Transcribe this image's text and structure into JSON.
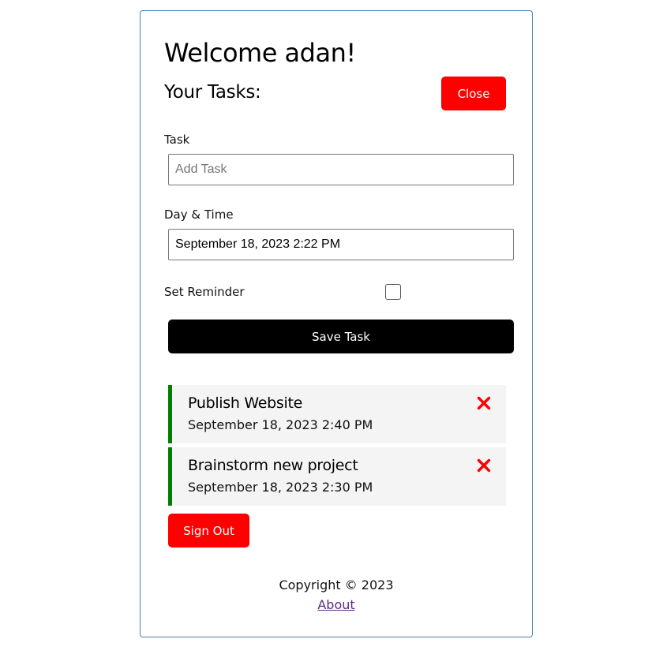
{
  "header": {
    "title": "Welcome adan!",
    "subtitle": "Your Tasks:",
    "close_label": "Close"
  },
  "form": {
    "task_label": "Task",
    "task_placeholder": "Add Task",
    "task_value": "",
    "datetime_label": "Day & Time",
    "datetime_value": "September 18, 2023 2:22 PM",
    "reminder_label": "Set Reminder",
    "reminder_checked": false,
    "save_label": "Save Task"
  },
  "tasks": [
    {
      "name": "Publish Website",
      "time": "September 18, 2023 2:40 PM",
      "reminder": true
    },
    {
      "name": "Brainstorm new project",
      "time": "September 18, 2023 2:30 PM",
      "reminder": true
    }
  ],
  "sign_out_label": "Sign Out",
  "footer": {
    "copyright": "Copyright © 2023",
    "about": "About"
  },
  "colors": {
    "accent": "#ff0000",
    "reminder_border": "#008000",
    "card_border": "#4682b4"
  },
  "icons": {
    "delete": "close-icon"
  }
}
